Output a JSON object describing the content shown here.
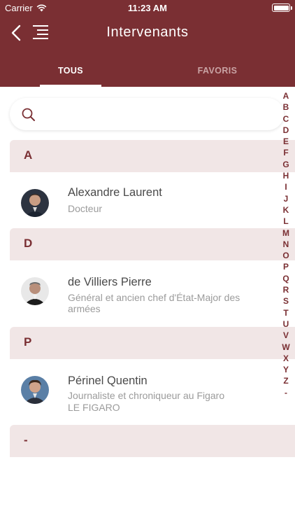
{
  "status_bar": {
    "carrier": "Carrier",
    "time": "11:23 AM"
  },
  "navbar": {
    "title": "Intervenants"
  },
  "tabs": [
    {
      "label": "TOUS",
      "active": true
    },
    {
      "label": "FAVORIS",
      "active": false
    }
  ],
  "search": {
    "value": "",
    "placeholder": ""
  },
  "sections": [
    {
      "letter": "A",
      "people": [
        {
          "name": "Alexandre Laurent",
          "title": "Docteur",
          "org": ""
        }
      ]
    },
    {
      "letter": "D",
      "people": [
        {
          "name": "de Villiers Pierre",
          "title": "Général et ancien chef d'État-Major des armées",
          "org": ""
        }
      ]
    },
    {
      "letter": "P",
      "people": [
        {
          "name": "Périnel Quentin",
          "title": "Journaliste et chroniqueur au Figaro",
          "org": "LE FIGARO"
        }
      ]
    },
    {
      "letter": "-",
      "people": []
    }
  ],
  "alphabet_index": [
    "A",
    "B",
    "C",
    "D",
    "E",
    "F",
    "G",
    "H",
    "I",
    "J",
    "K",
    "L",
    "M",
    "N",
    "O",
    "P",
    "Q",
    "R",
    "S",
    "T",
    "U",
    "V",
    "W",
    "X",
    "Y",
    "Z",
    "-"
  ],
  "colors": {
    "brand": "#7a2f33",
    "section_bg": "#f1e6e6",
    "inactive_tab": "#c9a3a4"
  },
  "icons": [
    "wifi-icon",
    "battery-icon",
    "back-chevron-icon",
    "menu-icon",
    "search-icon"
  ]
}
